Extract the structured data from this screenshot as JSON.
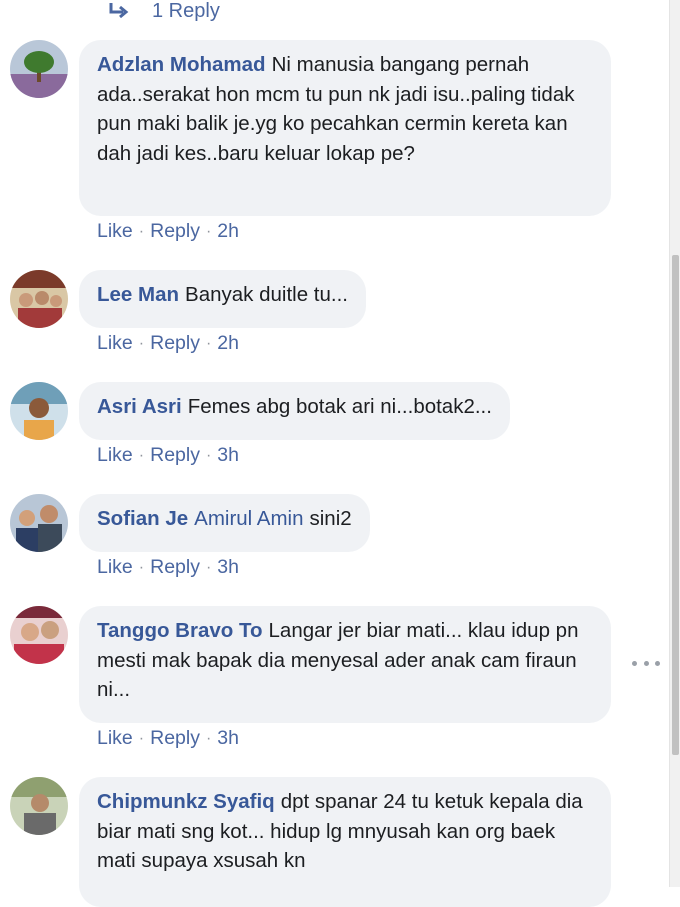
{
  "top_reply": {
    "label": "1 Reply"
  },
  "actions": {
    "like": "Like",
    "reply": "Reply",
    "sep": "·"
  },
  "comments": [
    {
      "name": "Adzlan Mohamad",
      "text": "Ni manusia bangang pernah ada..serakat hon mcm tu pun nk jadi isu..paling tidak pun maki balik je.yg ko pecahkan cermin kereta kan dah jadi kes..baru keluar lokap pe?",
      "time": "2h"
    },
    {
      "name": "Lee Man",
      "text": "Banyak duitle tu...",
      "time": "2h"
    },
    {
      "name": "Asri Asri",
      "text": "Femes abg botak ari ni...botak2...",
      "time": "3h"
    },
    {
      "name": "Sofian Je",
      "tag": "Amirul Amin",
      "text": "sini2",
      "time": "3h"
    },
    {
      "name": "Tanggo Bravo To",
      "text": "Langar jer biar mati... klau idup pn mesti mak bapak dia menyesal ader anak cam firaun ni...",
      "time": "3h"
    },
    {
      "name": "Chipmunkz Syafiq",
      "text": "dpt spanar 24 tu ketuk kepala dia biar mati sng kot... hidup lg mnyusah kan org baek mati supaya xsusah kn",
      "time": ""
    }
  ]
}
